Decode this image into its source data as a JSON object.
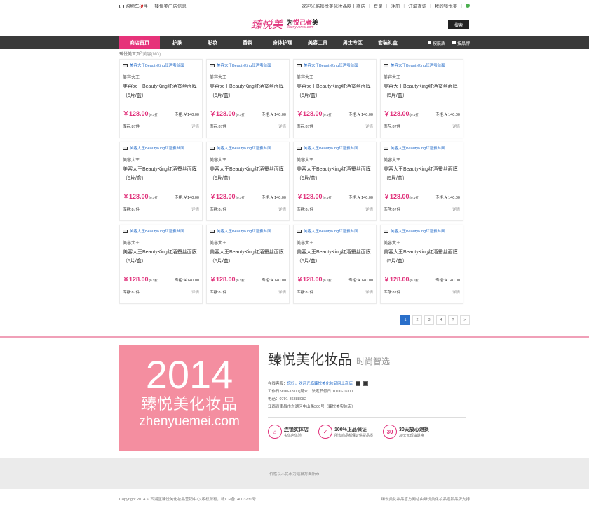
{
  "topbar": {
    "cart_pre": "购物车(",
    "cart_count": "0",
    "cart_post": "件",
    "store_info": "臻悦美门店信息",
    "welcome": "欢迎光临臻悦美化妆品网上商店",
    "login": "登录",
    "register": "注册",
    "order": "订单查询",
    "my": "我的臻悦美"
  },
  "header": {
    "logo_text": "臻悦美",
    "slogan_pre": "为",
    "slogan_mid": "悦己者",
    "slogan_post": "美",
    "slogan_url": "Zhenyuemei.com",
    "search_placeholder": "",
    "search_button": "搜索"
  },
  "nav": {
    "items": [
      "商店首页",
      "护肤",
      "彩妆",
      "香氛",
      "身体护理",
      "美容工具",
      "男士专区",
      "套装礼盒"
    ],
    "by_effect": "按肤质",
    "by_brand": "按品牌"
  },
  "breadcrumb": {
    "home": "臻悦美首页",
    "sep": " > ",
    "current": "美容(MG)"
  },
  "product_template": {
    "img_alt": "美容大王BeautyKing红酒蚕丝面",
    "brand": "美容大王",
    "name": "美容大王BeautyKing红酒蚕丝面膜（5片/盒）",
    "price": "￥128.00",
    "discount": "(9.1折)",
    "counter_price": "专柜:￥140.00",
    "stock": "库存:87件",
    "detail": "详情"
  },
  "pager": [
    "1",
    "2",
    "3",
    "4",
    "?",
    ">"
  ],
  "footer": {
    "banner_year": "2014",
    "banner_cn": "臻悦美化妆品",
    "banner_url": "zhenyuemei.com",
    "title": "臻悦美化妆品",
    "subtitle": "时尚智选",
    "online_label": "在线客服：",
    "online_link": "您好，欢迎光临臻悦美化妆品网上商店",
    "hours": "工作日 9:00-18:00(周末、法定节假日 10:00-16:00",
    "phone": "电话：0791-86888082",
    "address": "江西省南昌市东湖区中山路300号（臻悦美实体店）",
    "g1_title": "连锁实体店",
    "g1_sub": "实体店体验",
    "g2_title": "100%正品保证",
    "g2_sub": "所售商品都保证供货品质",
    "g3_title": "30天放心退换",
    "g3_sub": "30天无理由退换",
    "gray_note": "价格以人民币为结算方面所币",
    "copyright": "Copyright 2014 © 西湖区臻悦美化妆品营销中心 版权所有，赣ICP备14003230号",
    "right_note": "臻悦美化妆品官方网站由臻悦美化妆品连锁品牌支持"
  }
}
